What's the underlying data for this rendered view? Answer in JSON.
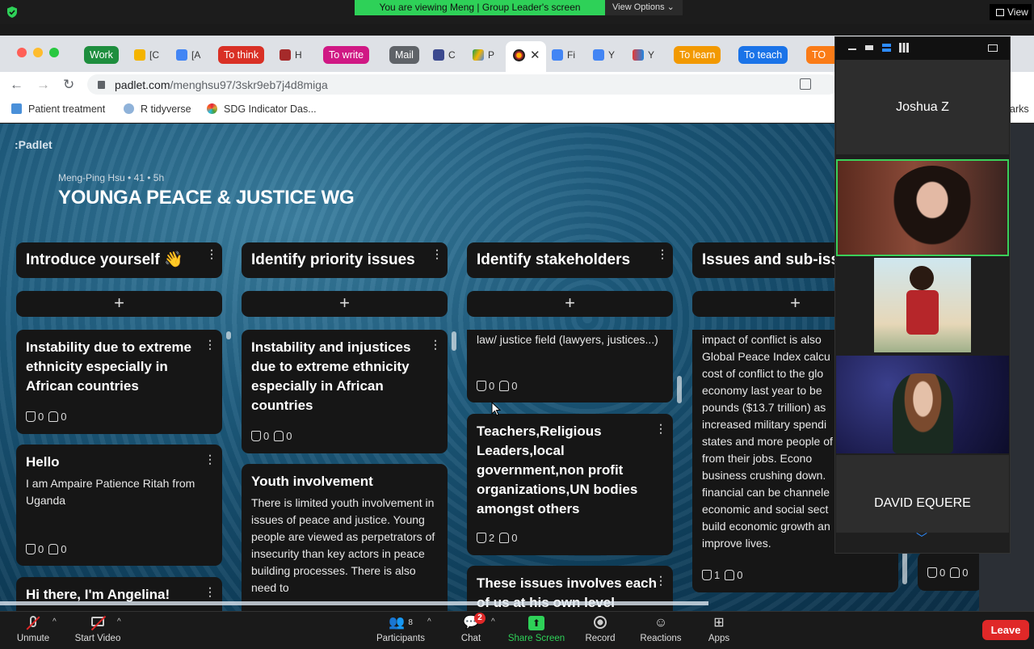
{
  "zoom_top": {
    "viewing_banner": "You are viewing Meng | Group Leader's screen",
    "view_options": "View Options ⌄",
    "view_button": "View"
  },
  "browser": {
    "tabs": [
      {
        "label": "Work",
        "color": "#1e8e3e"
      },
      {
        "label": "[C",
        "color": ""
      },
      {
        "label": "[A",
        "color": ""
      },
      {
        "label": "To think",
        "color": "#d93025"
      },
      {
        "label": "H",
        "color": ""
      },
      {
        "label": "To write",
        "color": "#d01884"
      },
      {
        "label": "Mail",
        "color": "#5f6368"
      },
      {
        "label": "C",
        "color": ""
      },
      {
        "label": "P",
        "color": ""
      },
      {
        "label": "Fi",
        "color": ""
      },
      {
        "label": "Y",
        "color": ""
      },
      {
        "label": "Y",
        "color": ""
      },
      {
        "label": "To learn",
        "color": "#f29900"
      },
      {
        "label": "To teach",
        "color": "#1a73e8"
      },
      {
        "label": "TO D",
        "color": "#fa7b17"
      }
    ],
    "url_host": "padlet.com",
    "url_path": "/menghsu97/3skr9eb7j4d8miga",
    "bookmarks": [
      "Patient treatment",
      "R tidyverse",
      "SDG Indicator Das..."
    ],
    "bookmarks_overflow": "arks"
  },
  "padlet": {
    "logo": ":Padlet",
    "meta": "Meng-Ping Hsu • 41 • 5h",
    "title": "YOUNGA PEACE & JUSTICE WG",
    "columns": [
      {
        "title": "Introduce yourself 👋"
      },
      {
        "title": "Identify priority issues"
      },
      {
        "title": "Identify stakeholders"
      },
      {
        "title": "Issues and sub-issues"
      }
    ],
    "add_symbol": "+",
    "cards": {
      "c1a": {
        "title": "Instability due to extreme ethnicity especially in African countries",
        "likes": "0",
        "dislikes": "0"
      },
      "c1b": {
        "title": "Hello",
        "body": "I am Ampaire Patience Ritah from Uganda",
        "likes": "0",
        "dislikes": "0"
      },
      "c1c": {
        "title": "Hi there, I'm Angelina!"
      },
      "c2a": {
        "title": "Instability and injustices due to extreme ethnicity especially in African countries",
        "likes": "0",
        "dislikes": "0"
      },
      "c2b": {
        "title": "Youth involvement",
        "body": "There is limited youth involvement in issues of peace and justice. Young people are viewed as perpetrators of insecurity than key actors in peace building processes. There is also need to"
      },
      "c3a": {
        "body": "law/ justice field (lawyers, justices...)",
        "likes": "0",
        "dislikes": "0"
      },
      "c3b": {
        "title": "Teachers,Religious Leaders,local government,non profit organizations,UN bodies amongst others",
        "likes": "2",
        "dislikes": "0"
      },
      "c3c": {
        "title": "These issues involves each of us at his own level"
      },
      "c4a": {
        "body": "impact of conflict is also Global Peace Index calcu cost of conflict to the glo economy last year to be pounds ($13.7 trillion) as increased military spendi states and more people of from their jobs. Econo business crushing down. financial can be channele economic and social sect build economic growth an improve lives.",
        "likes": "1",
        "dislikes": "0"
      },
      "c5a": {
        "likes": "0",
        "dislikes": "0"
      }
    }
  },
  "gallery": {
    "tiles": [
      {
        "name": "Joshua Z",
        "type": "name"
      },
      {
        "name": "",
        "type": "video-speaker"
      },
      {
        "name": "",
        "type": "video-cartoon"
      },
      {
        "name": "",
        "type": "video-space"
      },
      {
        "name": "DAVID EQUERE",
        "type": "name"
      }
    ]
  },
  "toolbar": {
    "unmute": "Unmute",
    "start_video": "Start Video",
    "participants": "Participants",
    "participants_count": "8",
    "chat": "Chat",
    "chat_badge": "2",
    "share_screen": "Share Screen",
    "record": "Record",
    "reactions": "Reactions",
    "apps": "Apps",
    "leave": "Leave"
  }
}
